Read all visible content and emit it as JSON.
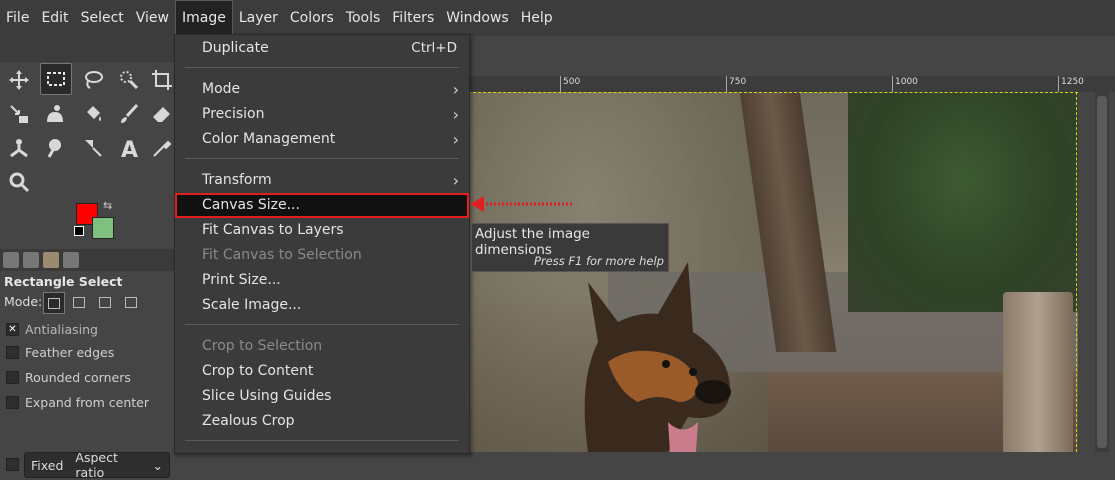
{
  "menubar": {
    "items": [
      "File",
      "Edit",
      "Select",
      "View",
      "Image",
      "Layer",
      "Colors",
      "Tools",
      "Filters",
      "Windows",
      "Help"
    ],
    "active": "Image"
  },
  "tool_options": {
    "title": "Rectangle Select",
    "mode_label": "Mode:",
    "antialiasing": "Antialiasing",
    "feather_edges": "Feather edges",
    "rounded_corners": "Rounded corners",
    "expand_from_center": "Expand from center",
    "fixed_label": "Fixed",
    "fixed_value": "Aspect ratio"
  },
  "colors": {
    "foreground": "#ff0000",
    "background": "#7fbf7f",
    "highlight": "#e02020"
  },
  "ruler": {
    "ticks": [
      "500",
      "750",
      "1000",
      "1250"
    ]
  },
  "image_menu": {
    "duplicate": "Duplicate",
    "duplicate_accel": "Ctrl+D",
    "mode": "Mode",
    "precision": "Precision",
    "color_management": "Color Management",
    "transform": "Transform",
    "canvas_size": "Canvas Size...",
    "fit_canvas_to_layers": "Fit Canvas to Layers",
    "fit_canvas_to_selection": "Fit Canvas to Selection",
    "print_size": "Print Size...",
    "scale_image": "Scale Image...",
    "crop_to_selection": "Crop to Selection",
    "crop_to_content": "Crop to Content",
    "slice_using_guides": "Slice Using Guides",
    "zealous_crop": "Zealous Crop"
  },
  "tooltip": {
    "text": "Adjust the image dimensions",
    "help": "Press F1 for more help"
  },
  "icons": [
    "move-icon",
    "rect-select-icon",
    "lasso-icon",
    "fuzzy-select-icon",
    "crop-icon",
    "warp-icon",
    "bucket-icon",
    "paintbrush-icon",
    "eraser-icon",
    "smudge-icon",
    "clone-icon",
    "path-icon",
    "text-icon",
    "zoom-icon",
    "color-picker-icon"
  ]
}
